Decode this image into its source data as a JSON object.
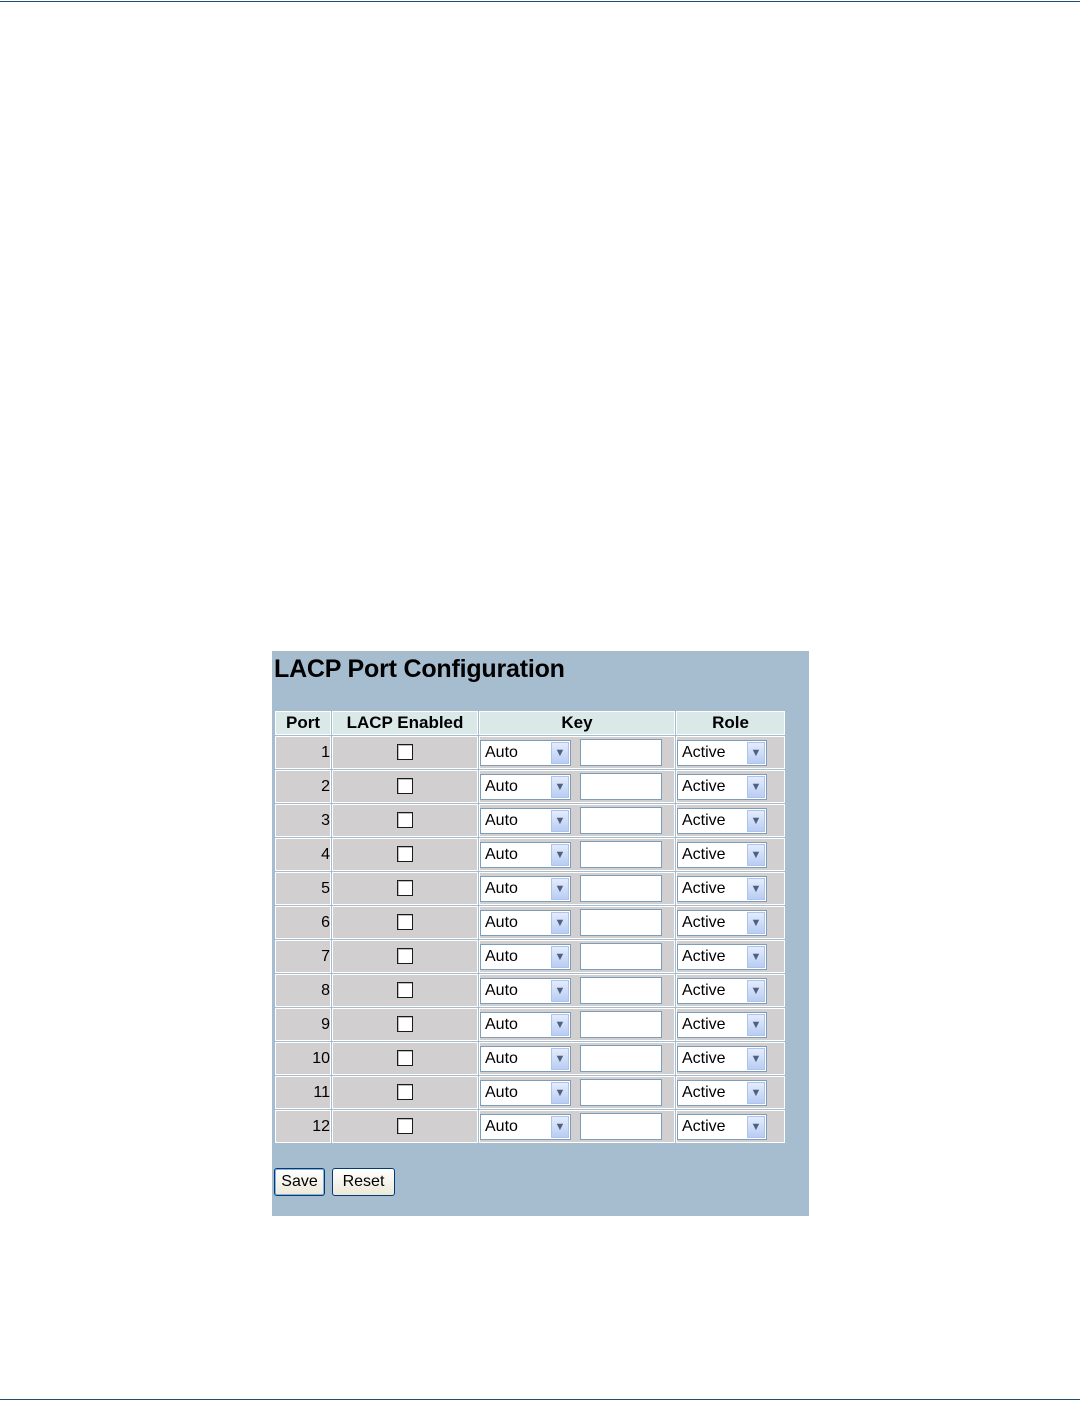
{
  "page": {
    "title": "LACP Port Configuration"
  },
  "table": {
    "headers": {
      "port": "Port",
      "lacp_enabled": "LACP Enabled",
      "key": "Key",
      "role": "Role"
    },
    "rows": [
      {
        "port": "1",
        "lacp_enabled": false,
        "key_mode": "Auto",
        "key_value": "",
        "role": "Active"
      },
      {
        "port": "2",
        "lacp_enabled": false,
        "key_mode": "Auto",
        "key_value": "",
        "role": "Active"
      },
      {
        "port": "3",
        "lacp_enabled": false,
        "key_mode": "Auto",
        "key_value": "",
        "role": "Active"
      },
      {
        "port": "4",
        "lacp_enabled": false,
        "key_mode": "Auto",
        "key_value": "",
        "role": "Active"
      },
      {
        "port": "5",
        "lacp_enabled": false,
        "key_mode": "Auto",
        "key_value": "",
        "role": "Active"
      },
      {
        "port": "6",
        "lacp_enabled": false,
        "key_mode": "Auto",
        "key_value": "",
        "role": "Active"
      },
      {
        "port": "7",
        "lacp_enabled": false,
        "key_mode": "Auto",
        "key_value": "",
        "role": "Active"
      },
      {
        "port": "8",
        "lacp_enabled": false,
        "key_mode": "Auto",
        "key_value": "",
        "role": "Active"
      },
      {
        "port": "9",
        "lacp_enabled": false,
        "key_mode": "Auto",
        "key_value": "",
        "role": "Active"
      },
      {
        "port": "10",
        "lacp_enabled": false,
        "key_mode": "Auto",
        "key_value": "",
        "role": "Active"
      },
      {
        "port": "11",
        "lacp_enabled": false,
        "key_mode": "Auto",
        "key_value": "",
        "role": "Active"
      },
      {
        "port": "12",
        "lacp_enabled": false,
        "key_mode": "Auto",
        "key_value": "",
        "role": "Active"
      }
    ]
  },
  "buttons": {
    "save_label": "Save",
    "reset_label": "Reset"
  },
  "colors": {
    "panel_bg": "#a6bccf",
    "header_bg": "#dbe8e8",
    "cell_bg": "#d1cfcf",
    "page_rule": "#1f4e6e"
  },
  "icons": {
    "select_arrow": "chevron-down-icon"
  }
}
